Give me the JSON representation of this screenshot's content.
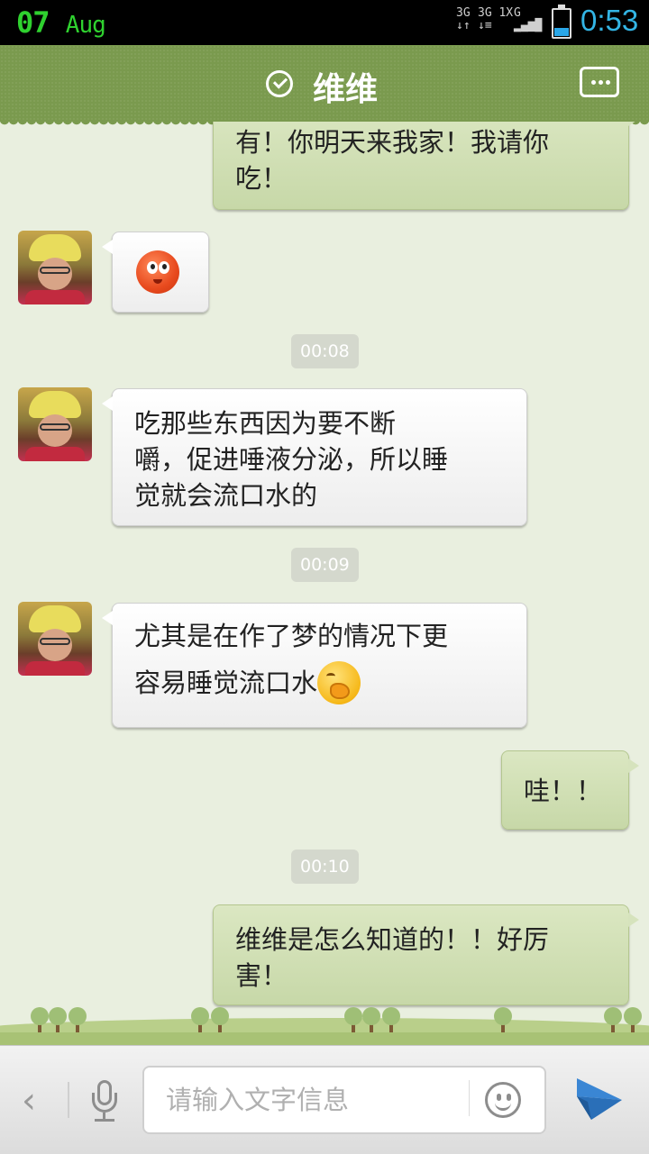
{
  "status_bar": {
    "date_day": "07",
    "date_month": "Aug",
    "network_1": "3G",
    "network_2": "3G 1X",
    "network_3": "G",
    "time": "0:53"
  },
  "header": {
    "title": "维维",
    "verified_icon": "check-circle-icon",
    "menu_icon": "more-dots-icon"
  },
  "messages": [
    {
      "side": "right",
      "text": "有！你明天来我家！我请你吃！"
    },
    {
      "side": "left",
      "emoji": "blush-emoji"
    },
    {
      "timestamp": "00:08"
    },
    {
      "side": "left",
      "text": "吃那些东西因为要不断嚼，促进唾液分泌，所以睡觉就会流口水的"
    },
    {
      "timestamp": "00:09"
    },
    {
      "side": "left",
      "text": "尤其是在作了梦的情况下更容易睡觉流口水",
      "emoji": "giggle-emoji"
    },
    {
      "side": "right",
      "text": "哇！！"
    },
    {
      "timestamp": "00:10"
    },
    {
      "side": "right",
      "text": "维维是怎么知道的！！好厉害！"
    }
  ],
  "m1": {
    "line1": "有！你明天来我家！我请你",
    "line2": "吃！"
  },
  "m3": {
    "line1": "吃那些东西因为要不断",
    "line2": "嚼，促进唾液分泌，所以睡",
    "line3": "觉就会流口水的"
  },
  "m4": {
    "line1": "尤其是在作了梦的情况下更",
    "line2": "容易睡觉流口水"
  },
  "m5": {
    "text": "哇！！"
  },
  "m6": {
    "line1": "维维是怎么知道的！！好厉",
    "line2": "害！"
  },
  "timestamps": [
    "00:08",
    "00:09",
    "00:10"
  ],
  "input_bar": {
    "placeholder": "请输入文字信息",
    "back_icon": "chevron-left-icon",
    "mic_icon": "microphone-icon",
    "emoji_icon": "smiley-icon",
    "send_icon": "paper-plane-icon"
  },
  "colors": {
    "header_bg": "#7a9a4e",
    "status_time": "#33b5e5",
    "status_date": "#2fd12f",
    "chat_bg": "#e9efdf",
    "bubble_right": "#d6e3bd",
    "bubble_left": "#ffffff",
    "send_icon": "#3a86d4"
  }
}
